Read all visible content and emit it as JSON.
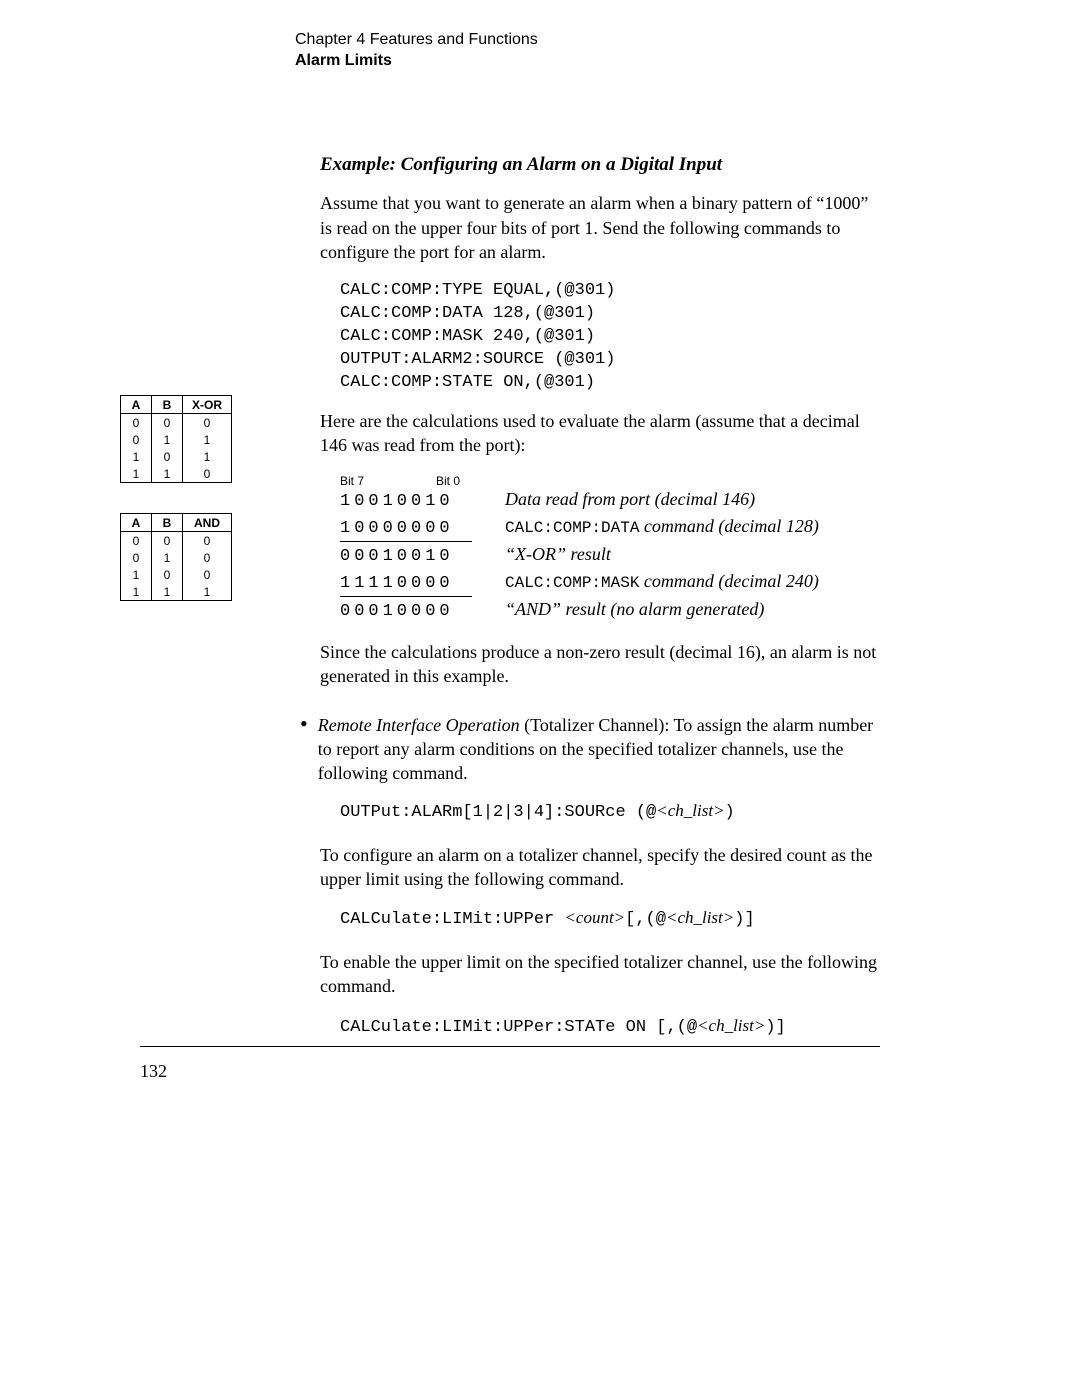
{
  "header": {
    "chapter": "Chapter 4  Features and Functions",
    "section": "Alarm Limits"
  },
  "example_title": "Example:  Configuring an Alarm on a Digital Input",
  "intro_para": "Assume that you want to generate an alarm when a binary pattern of “1000” is read on the upper four bits of port 1. Send the following commands to configure the port for an alarm.",
  "code1": "CALC:COMP:TYPE EQUAL,(@301)\nCALC:COMP:DATA 128,(@301)\nCALC:COMP:MASK 240,(@301)\nOUTPUT:ALARM2:SOURCE (@301)\nCALC:COMP:STATE ON,(@301)",
  "calc_intro": "Here are the calculations used to evaluate the alarm (assume that a decimal 146 was read from the port):",
  "truth_tables": {
    "xor": {
      "headers": [
        "A",
        "B",
        "X-OR"
      ],
      "rows": [
        [
          "0",
          "0",
          "0"
        ],
        [
          "0",
          "1",
          "1"
        ],
        [
          "1",
          "0",
          "1"
        ],
        [
          "1",
          "1",
          "0"
        ]
      ]
    },
    "and": {
      "headers": [
        "A",
        "B",
        "AND"
      ],
      "rows": [
        [
          "0",
          "0",
          "0"
        ],
        [
          "0",
          "1",
          "0"
        ],
        [
          "1",
          "0",
          "0"
        ],
        [
          "1",
          "1",
          "1"
        ]
      ]
    }
  },
  "bitlabels": {
    "b7": "Bit 7",
    "b0": "Bit 0"
  },
  "bitcalc": [
    {
      "bits": "10010010",
      "desc": "Data read from port (decimal 146)",
      "cmd": ""
    },
    {
      "bits": "10000000",
      "desc": " command (decimal 128)",
      "cmd": "CALC:COMP:DATA"
    },
    {
      "bits": "00010010",
      "desc": "“X-OR” result",
      "cmd": ""
    },
    {
      "bits": "11110000",
      "desc": " command (decimal 240)",
      "cmd": "CALC:COMP:MASK"
    },
    {
      "bits": "00010000",
      "desc": "“AND” result (no alarm generated)",
      "cmd": ""
    }
  ],
  "result_para": "Since the calculations produce a non-zero result (decimal 16), an alarm is not generated in this example.",
  "bullet": {
    "lead": "Remote Interface Operation",
    "tail": " (Totalizer Channel):  To assign the alarm number to report any alarm conditions on the specified totalizer channels, use the following command."
  },
  "code2": {
    "pre": "OUTPut:ALARm[1|2|3|4]:SOURce (@",
    "arg": "<ch_list>",
    "post": ")"
  },
  "para3": "To configure an alarm on a totalizer channel, specify the desired count as the upper limit using the following command.",
  "code3": {
    "pre": "CALCulate:LIMit:UPPer ",
    "a1": "<count>",
    "mid": "[,(@",
    "a2": "<ch_list>",
    "post": ")]"
  },
  "para4": "To enable the upper limit on the specified totalizer channel, use the following command.",
  "code4": {
    "pre": "CALCulate:LIMit:UPPer:STATe ON [,(@",
    "arg": "<ch_list>",
    "post": ")]"
  },
  "page_number": "132"
}
